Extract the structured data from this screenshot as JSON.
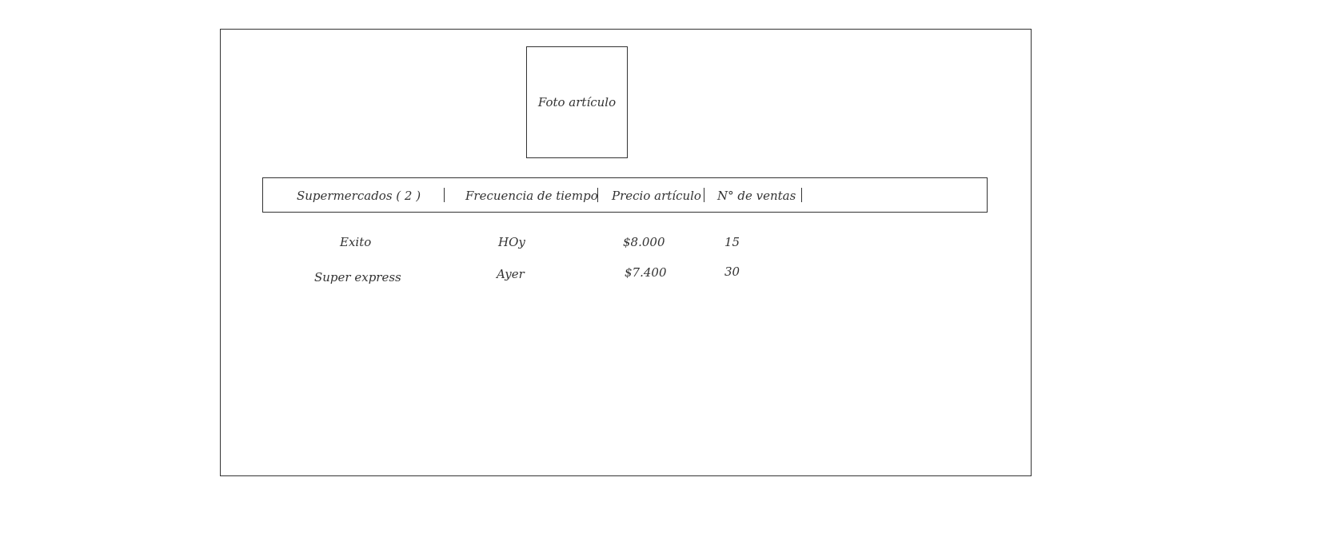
{
  "photo": {
    "label": "Foto artículo"
  },
  "table": {
    "columns": [
      "Supermercados ( 2 )",
      "Frecuencia de tiempo",
      "Precio artículo",
      "N° de ventas"
    ],
    "rows": [
      [
        "Exito",
        "HOy",
        "$8.000",
        "15"
      ],
      [
        "Super express",
        "Ayer",
        "$7.400",
        "30"
      ]
    ]
  }
}
